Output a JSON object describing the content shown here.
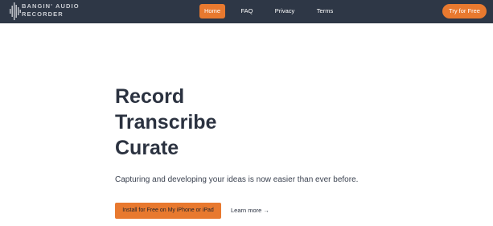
{
  "brand": {
    "line1": "BANGIN' AUDIO",
    "line2": "RECORDER",
    "logo_icon": "waveform-icon"
  },
  "nav": {
    "home": "Home",
    "faq": "FAQ",
    "privacy": "Privacy",
    "terms": "Terms",
    "cta": "Try for Free"
  },
  "hero": {
    "lines": [
      "Record",
      "Transcribe",
      "Curate"
    ],
    "tagline": "Capturing and developing your ideas is now easier than ever before.",
    "install_label": "Install for Free on My iPhone or iPad",
    "learn_more_label": "Learn more →"
  },
  "colors": {
    "nav_bg": "#2e3746",
    "accent": "#e8792f",
    "heading": "#2b3240"
  }
}
